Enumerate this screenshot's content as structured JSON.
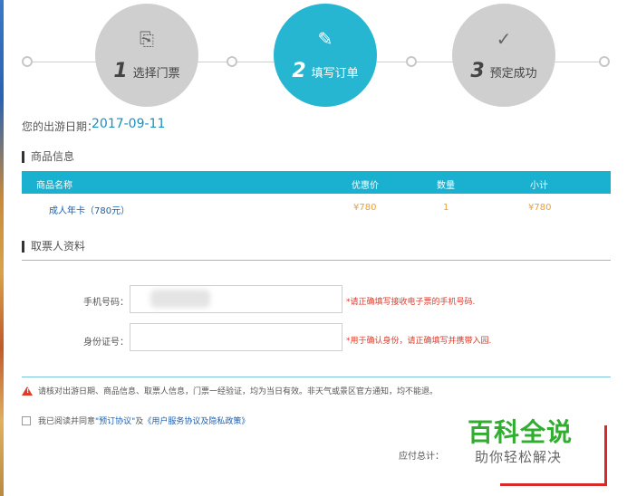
{
  "steps": [
    {
      "num": "1",
      "label": "选择门票",
      "icon": "ticket-icon",
      "state": "done"
    },
    {
      "num": "2",
      "label": "填写订单",
      "icon": "edit-icon",
      "state": "active"
    },
    {
      "num": "3",
      "label": "预定成功",
      "icon": "check-icon",
      "state": "todo"
    }
  ],
  "travel_date": {
    "label": "您的出游日期：",
    "value": "2017-09-11"
  },
  "product_section": {
    "title": "商品信息"
  },
  "table": {
    "headers": [
      "商品名称",
      "优惠价",
      "数量",
      "小计"
    ],
    "rows": [
      [
        "成人年卡（780元）",
        "¥780",
        "1",
        "¥780"
      ]
    ]
  },
  "ticket_holder": {
    "title": "取票人资料",
    "phone": {
      "label": "手机号码：",
      "value": "",
      "hint": "*请正确填写接收电子票的手机号码."
    },
    "id_card": {
      "label": "身份证号：",
      "value": "",
      "hint": "*用于确认身份，请正确填写并携带入园."
    }
  },
  "notice": "请核对出游日期、商品信息、取票人信息，门票一经验证，均为当日有效。非天气或景区官方通知，均不能退。",
  "agreement": {
    "prefix": "我已阅读并同意",
    "link1": "\"预订协议\"",
    "mid": "及",
    "link2": "《用户服务协议及隐私政策》"
  },
  "total": {
    "label": "应付总计："
  },
  "watermark": {
    "line1": "百科全说",
    "line2": "助你轻松解决"
  },
  "colors": {
    "accent": "#1ab0cf",
    "warning": "#e03a2a",
    "price": "#f0a030",
    "link": "#1a5fb0"
  }
}
